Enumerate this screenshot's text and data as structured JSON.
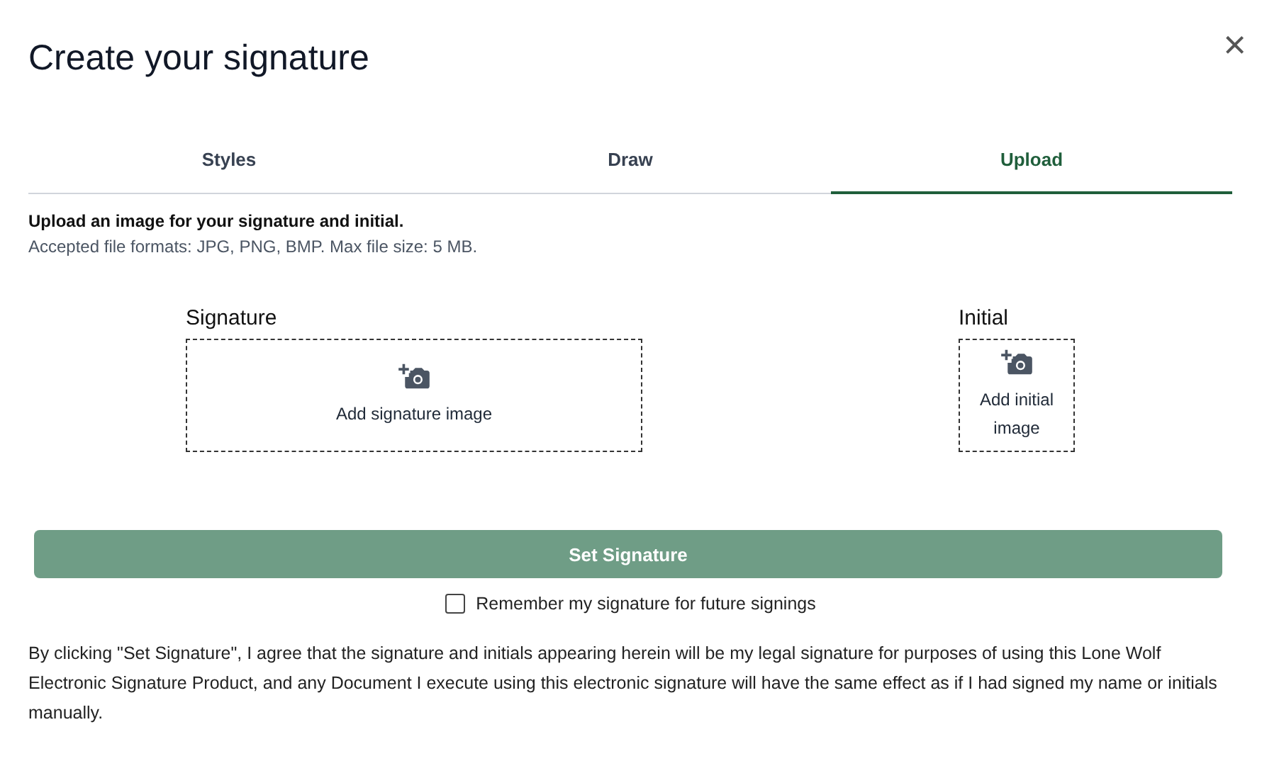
{
  "dialog": {
    "title": "Create your signature",
    "close": "×"
  },
  "tabs": [
    {
      "label": "Styles",
      "selected": false
    },
    {
      "label": "Draw",
      "selected": false
    },
    {
      "label": "Upload",
      "selected": true
    }
  ],
  "instructions": {
    "heading": "Upload an image for your signature and initial.",
    "note": "Accepted file formats: JPG, PNG, BMP. Max file size: 5 MB."
  },
  "uploads": [
    {
      "label": "Signature",
      "prompt": "Add signature image",
      "kind": "wide"
    },
    {
      "label": "Initial",
      "prompt": "Add initial image",
      "kind": "narrow"
    }
  ],
  "submit": {
    "label": "Set Signature",
    "disabled": true
  },
  "remember": {
    "label": "Remember my signature for future signings",
    "checked": false
  },
  "disclaimer": "By clicking \"Set Signature\", I agree that the signature and initials appearing herein will be my legal signature for purposes of using this Lone Wolf Electronic Signature Product, and any Document I execute using this electronic signature will have the same effect as if I had signed my name or initials manually."
}
